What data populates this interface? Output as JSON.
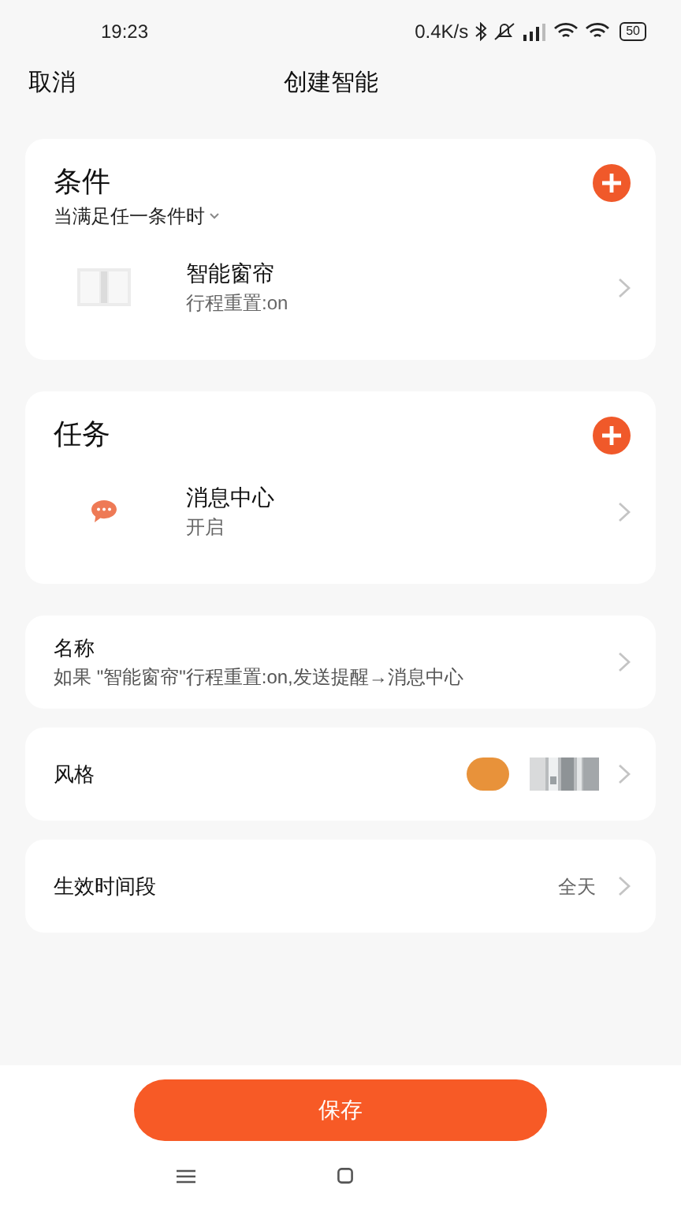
{
  "status_bar": {
    "time": "19:23",
    "net_speed": "0.4K/s",
    "battery": "50"
  },
  "header": {
    "cancel": "取消",
    "title": "创建智能"
  },
  "sections": [
    {
      "title": "条件",
      "subtitle": "当满足任一条件时",
      "items": [
        {
          "kind": "curtain",
          "name": "智能窗帘",
          "detail": "行程重置:on"
        }
      ]
    },
    {
      "title": "任务",
      "items": [
        {
          "kind": "message",
          "name": "消息中心",
          "detail": "开启"
        }
      ]
    }
  ],
  "settings": [
    {
      "kind": "text",
      "label": "名称",
      "value": "如果 \"智能窗帘\"行程重置:on,发送提醒→消息中心"
    },
    {
      "kind": "style",
      "label": "风格"
    },
    {
      "kind": "value",
      "label": "生效时间段",
      "value": "全天"
    }
  ],
  "save_button": "保存"
}
